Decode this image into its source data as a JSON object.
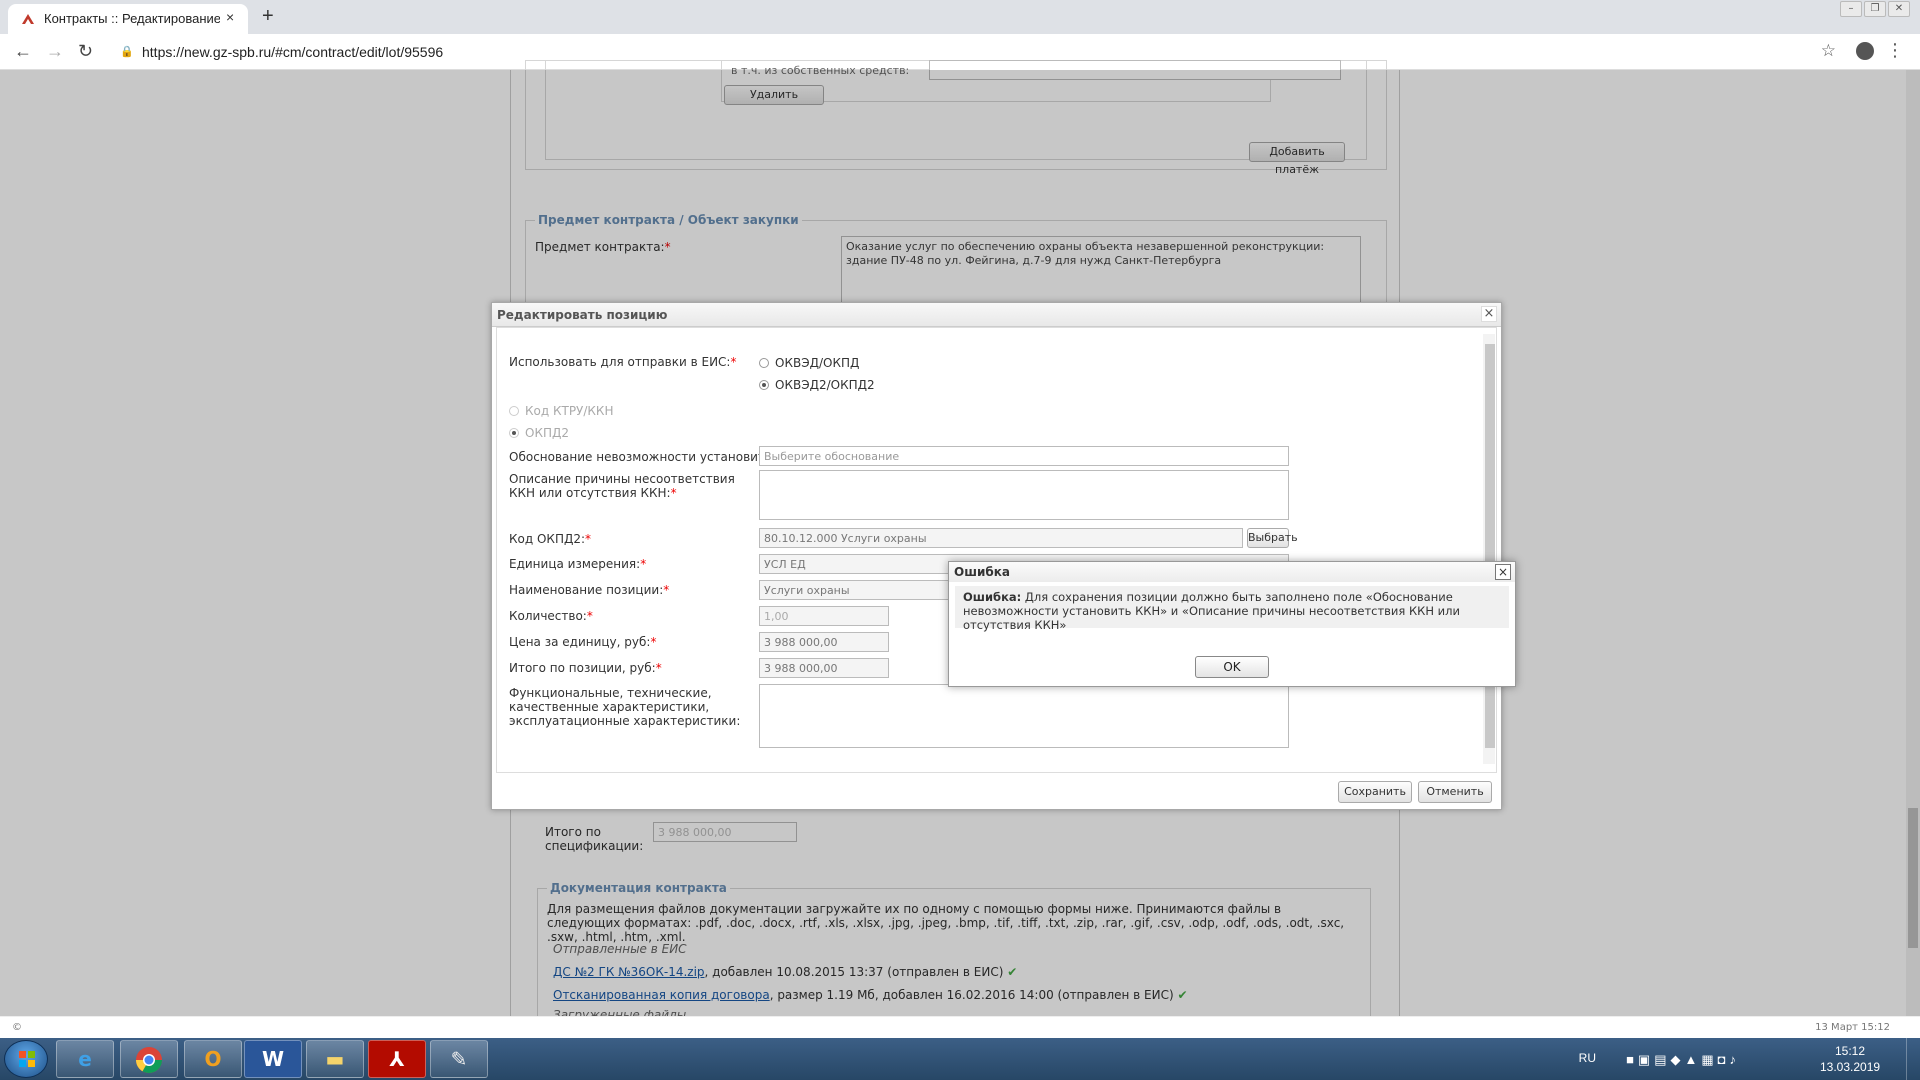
{
  "browser": {
    "tab_title": "Контракты :: Редактирование ко",
    "tab_close": "×",
    "new_tab": "+",
    "url": "https://new.gz-spb.ru/#cm/contract/edit/lot/95596"
  },
  "background": {
    "cut_label": "в т.ч. из собственных средств:",
    "delete_button": "Удалить",
    "add_payment_button": "Добавить платёж",
    "subject_group_title": "Предмет контракта / Объект закупки",
    "subject_label": "Предмет контракта:",
    "subject_value": "Оказание услуг по обеспечению охраны объекта незавершенной реконструкции: здание ПУ-48 по ул. Фейгина, д.7-9 для нужд Санкт-Петербурга",
    "total_spec_label": "Итого по спецификации:",
    "total_spec_value": "3 988 000,00",
    "docs_group_title": "Документация контракта",
    "docs_desc": "Для размещения файлов документации загружайте их по одному с помощью формы ниже. Принимаются файлы в следующих форматах: .pdf, .doc, .docx, .rtf, .xls, .xlsx, .jpg, .jpeg, .bmp, .tif, .tiff, .txt, .zip, .rar, .gif, .csv, .odp, .odf, .ods, .odt, .sxc, .sxw, .html, .htm, .xml.",
    "sent_label": "Отправленные в ЕИС",
    "file1_link": "ДС №2 ГК №36ОК-14.zip",
    "file1_info": ", добавлен 10.08.2015 13:37 (отправлен в ЕИС)",
    "file2_link": "Отсканированная копия договора",
    "file2_info": ", размер 1.19 Мб, добавлен 16.02.2016 14:00 (отправлен в ЕИС)",
    "loaded_label": "Загруженные файлы",
    "footer_left": "©",
    "footer_right": "13 Март 15:12"
  },
  "edit_dialog": {
    "title": "Редактировать позицию",
    "use_eis_label": "Использовать для отправки в ЕИС:",
    "opt_okved_okpd": "ОКВЭД/ОКПД",
    "opt_okved2_okpd2": "ОКВЭД2/ОКПД2",
    "opt_ktru": "Код КТРУ/ККН",
    "opt_okpd2": "ОКПД2",
    "reason_label": "Обоснование невозможности установить ККН:",
    "reason_placeholder": "Выберите обоснование",
    "desc_label": "Описание причины несоответствия ККН или отсутствия ККН:",
    "desc_value": "",
    "okpd2_label": "Код ОКПД2:",
    "okpd2_value": "80.10.12.000 Услуги охраны",
    "choose_button": "Выбрать",
    "unit_label": "Единица измерения:",
    "unit_value": "УСЛ ЕД",
    "name_label": "Наименование позиции:",
    "name_value": "Услуги охраны",
    "qty_label": "Количество:",
    "qty_value": "1,00",
    "price_label": "Цена за единицу, руб:",
    "price_value": "3 988 000,00",
    "total_label": "Итого по позиции, руб:",
    "total_value": "3 988 000,00",
    "chars_label": "Функциональные, технические, качественные характеристики, эксплуатационные характеристики:",
    "chars_value": "",
    "save_button": "Сохранить",
    "cancel_button": "Отменить",
    "req": "*"
  },
  "error_dialog": {
    "title": "Ошибка",
    "message_bold": "Ошибка:",
    "message": " Для сохранения позиции должно быть заполнено поле «Обоснование невозможности установить ККН» и «Описание причины несоответствия ККН или отсутствия ККН»",
    "ok_button": "OK"
  },
  "taskbar": {
    "word_label": "W",
    "lang": "RU",
    "time": "15:12",
    "date": "13.03.2019"
  }
}
